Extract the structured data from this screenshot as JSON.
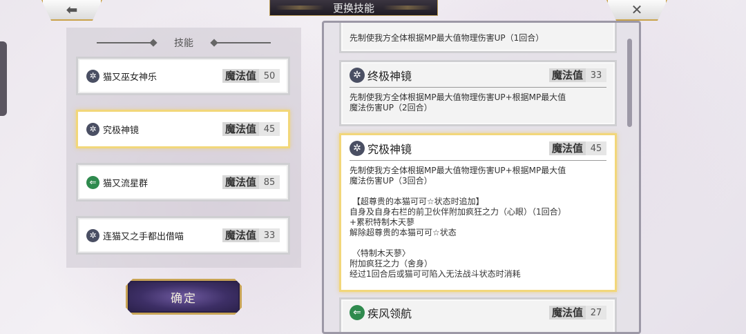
{
  "nav": {
    "back_icon": "arrow-left-icon",
    "close_icon": "close-icon"
  },
  "title": "更换技能",
  "left_panel": {
    "header": "技能",
    "mp_label": "魔法值",
    "skills": [
      {
        "name": "猫又巫女神乐",
        "mp": "50",
        "icon": "compass-icon"
      },
      {
        "name": "究极神镜",
        "mp": "45",
        "icon": "compass-icon"
      },
      {
        "name": "猫又流星群",
        "mp": "85",
        "icon": "arrow-left-icon"
      },
      {
        "name": "连猫又之手都出借喵",
        "mp": "33",
        "icon": "compass-icon"
      }
    ]
  },
  "confirm_label": "确定",
  "right_panel": {
    "mp_label": "魔法值",
    "cards": [
      {
        "desc": "先制使我方全体根据MP最大值物理伤害UP（1回合）"
      },
      {
        "name": "终极神镜",
        "mp": "33",
        "desc": "先制使我方全体根据MP最大值物理伤害UP+根据MP最大值\n魔法伤害UP（2回合）"
      },
      {
        "name": "究极神镜",
        "mp": "45",
        "desc": "先制使我方全体根据MP最大值物理伤害UP+根据MP最大值\n魔法伤害UP（3回合）\n\n 【超尊贵的本猫可可☆状态时追加】\n自身及自身右栏的前卫伙伴附加疯狂之力（心眼）（1回合）\n+累积特制木天蓼\n解除超尊贵的本猫可可☆状态\n\n 〈特制木天蓼〉\n附加疯狂之力（舍身）\n经过1回合后或猫可可陷入无法战斗状态时消耗"
      },
      {
        "name": "疾风领航",
        "mp": "27"
      }
    ]
  },
  "colors": {
    "selected_border": "#f2d77a",
    "confirm_bg": "#3d2f66",
    "gold_trim": "#c8a456"
  }
}
